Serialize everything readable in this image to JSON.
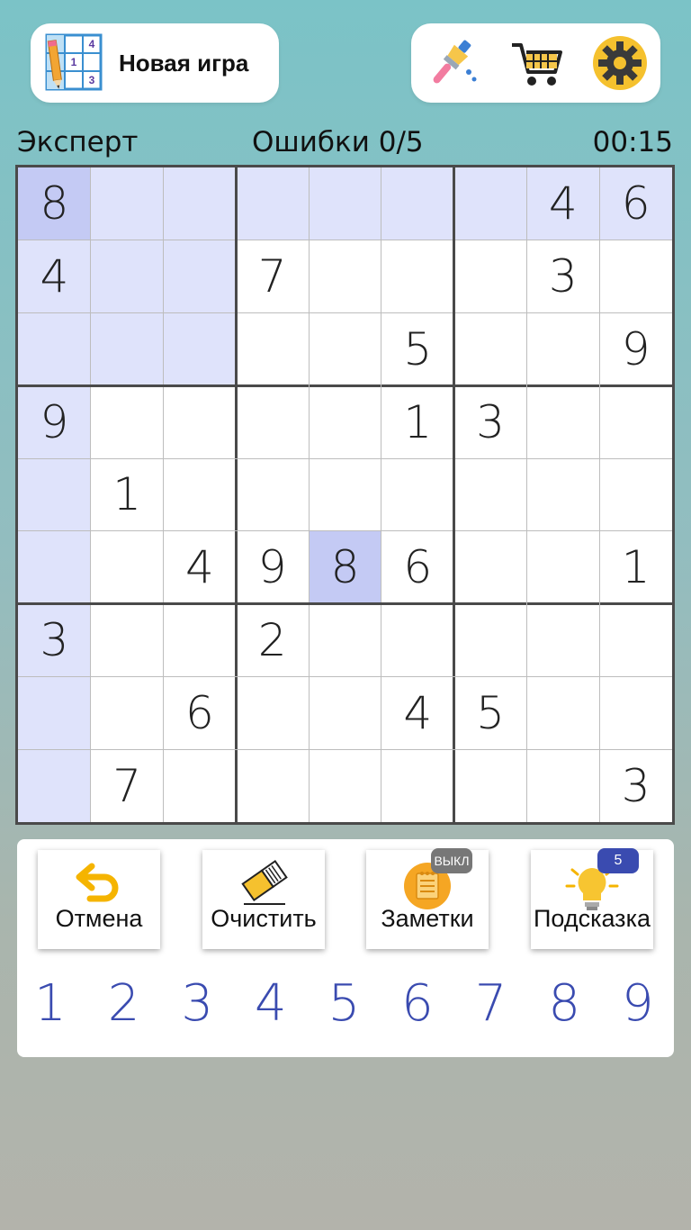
{
  "header": {
    "new_game_label": "Новая игра",
    "new_game_icon": "sudoku-grid-pencil-icon",
    "new_game_icon_digits": [
      "4",
      "1",
      "3"
    ],
    "tools": [
      {
        "name": "paint-brush-icon"
      },
      {
        "name": "shopping-cart-icon"
      },
      {
        "name": "gear-icon"
      }
    ]
  },
  "status": {
    "difficulty": "Эксперт",
    "mistakes": "Ошибки 0/5",
    "timer": "00:15"
  },
  "board": {
    "rows": [
      [
        "8",
        "",
        "",
        "",
        "",
        "",
        "",
        "4",
        "6"
      ],
      [
        "4",
        "",
        "",
        "7",
        "",
        "",
        "",
        "3",
        ""
      ],
      [
        "",
        "",
        "",
        "",
        "",
        "5",
        "",
        "",
        "9"
      ],
      [
        "9",
        "",
        "",
        "",
        "",
        "1",
        "3",
        "",
        ""
      ],
      [
        "",
        "1",
        "",
        "",
        "",
        "",
        "",
        "",
        ""
      ],
      [
        "",
        "",
        "4",
        "9",
        "8",
        "6",
        "",
        "",
        "1"
      ],
      [
        "3",
        "",
        "",
        "2",
        "",
        "",
        "",
        "",
        ""
      ],
      [
        "",
        "",
        "6",
        "",
        "",
        "4",
        "5",
        "",
        ""
      ],
      [
        "",
        "7",
        "",
        "",
        "",
        "",
        "",
        "",
        "3"
      ]
    ],
    "selected": [
      5,
      4
    ],
    "highlighted_color": "#dfe3fb",
    "selected_color": "#c4caf4",
    "accent_digit_color": "#3a4bb0"
  },
  "actions": [
    {
      "key": "undo",
      "label": "Отмена",
      "icon": "undo-arrow-icon"
    },
    {
      "key": "erase",
      "label": "Очистить",
      "icon": "eraser-icon"
    },
    {
      "key": "notes",
      "label": "Заметки",
      "icon": "notepad-icon",
      "badge": "ВЫКЛ"
    },
    {
      "key": "hint",
      "label": "Подсказка",
      "icon": "lightbulb-icon",
      "badge": "5"
    }
  ],
  "numpad": [
    "1",
    "2",
    "3",
    "4",
    "5",
    "6",
    "7",
    "8",
    "9"
  ]
}
